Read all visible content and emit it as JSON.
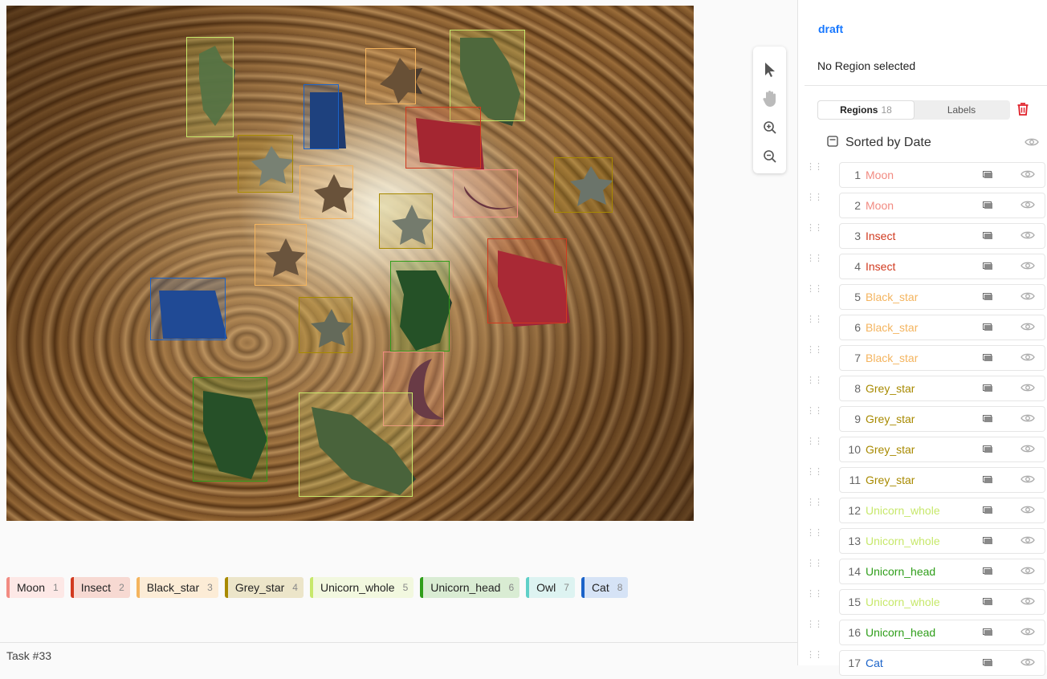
{
  "sidebar": {
    "draft_label": "draft",
    "no_region_text": "No Region selected",
    "tabs": {
      "regions_label": "Regions",
      "regions_count": "18",
      "labels_label": "Labels"
    },
    "sort_label": "Sorted by Date"
  },
  "regions": [
    {
      "idx": "1",
      "label": "Moon",
      "color": "#f28b82"
    },
    {
      "idx": "2",
      "label": "Moon",
      "color": "#f28b82"
    },
    {
      "idx": "3",
      "label": "Insect",
      "color": "#d13a1f"
    },
    {
      "idx": "4",
      "label": "Insect",
      "color": "#d13a1f"
    },
    {
      "idx": "5",
      "label": "Black_star",
      "color": "#f4b45e"
    },
    {
      "idx": "6",
      "label": "Black_star",
      "color": "#f4b45e"
    },
    {
      "idx": "7",
      "label": "Black_star",
      "color": "#f4b45e"
    },
    {
      "idx": "8",
      "label": "Grey_star",
      "color": "#a88a00"
    },
    {
      "idx": "9",
      "label": "Grey_star",
      "color": "#a88a00"
    },
    {
      "idx": "10",
      "label": "Grey_star",
      "color": "#a88a00"
    },
    {
      "idx": "11",
      "label": "Grey_star",
      "color": "#a88a00"
    },
    {
      "idx": "12",
      "label": "Unicorn_whole",
      "color": "#c7e86b"
    },
    {
      "idx": "13",
      "label": "Unicorn_whole",
      "color": "#c7e86b"
    },
    {
      "idx": "14",
      "label": "Unicorn_head",
      "color": "#2f9e1a"
    },
    {
      "idx": "15",
      "label": "Unicorn_whole",
      "color": "#c7e86b"
    },
    {
      "idx": "16",
      "label": "Unicorn_head",
      "color": "#2f9e1a"
    },
    {
      "idx": "17",
      "label": "Cat",
      "color": "#1b63c9"
    }
  ],
  "label_bar": [
    {
      "name": "Moon",
      "num": "1",
      "color": "#f28b82",
      "bg": "#fde8e6"
    },
    {
      "name": "Insect",
      "num": "2",
      "color": "#d13a1f",
      "bg": "#f7d9d2"
    },
    {
      "name": "Black_star",
      "num": "3",
      "color": "#f4b45e",
      "bg": "#fcecd6"
    },
    {
      "name": "Grey_star",
      "num": "4",
      "color": "#a88a00",
      "bg": "#ece5c9"
    },
    {
      "name": "Unicorn_whole",
      "num": "5",
      "color": "#c7e86b",
      "bg": "#f2f8df"
    },
    {
      "name": "Unicorn_head",
      "num": "6",
      "color": "#2f9e1a",
      "bg": "#d9ecd3"
    },
    {
      "name": "Owl",
      "num": "7",
      "color": "#5fd0c8",
      "bg": "#ddf3f1"
    },
    {
      "name": "Cat",
      "num": "8",
      "color": "#1b63c9",
      "bg": "#d6e3f6"
    }
  ],
  "task_label": "Task #33",
  "icons": {
    "select": "cursor-icon",
    "pan": "hand-icon",
    "zoom_in": "zoom-in-icon",
    "zoom_out": "zoom-out-icon",
    "trash": "trash-icon",
    "sort": "sort-icon",
    "eye": "eye-icon",
    "rect": "rectangle-icon"
  }
}
